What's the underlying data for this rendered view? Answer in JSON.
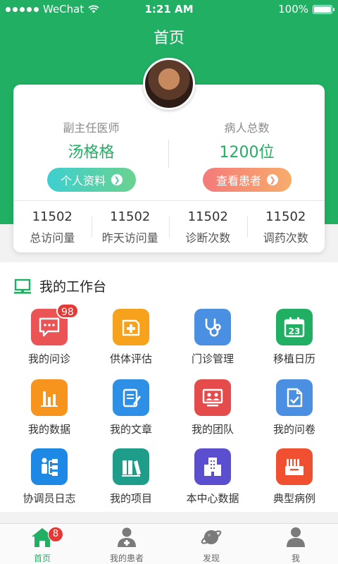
{
  "status_bar": {
    "carrier": "WeChat",
    "time": "1:21 AM",
    "battery": "100%"
  },
  "nav": {
    "title": "首页"
  },
  "profile": {
    "left": {
      "label": "副主任医师",
      "value": "汤格格",
      "button": "个人资料"
    },
    "right": {
      "label": "病人总数",
      "value": "1200位",
      "button": "查看患者"
    },
    "stats": [
      {
        "value": "11502",
        "label": "总访问量"
      },
      {
        "value": "11502",
        "label": "昨天访问量"
      },
      {
        "value": "11502",
        "label": "诊断次数"
      },
      {
        "value": "11502",
        "label": "调药次数"
      }
    ]
  },
  "workbench": {
    "title": "我的工作台",
    "items": [
      {
        "label": "我的问诊",
        "icon": "chat-icon",
        "color": "#ea5455",
        "badge": "98"
      },
      {
        "label": "供体评估",
        "icon": "medical-kit-icon",
        "color": "#f7a21c"
      },
      {
        "label": "门诊管理",
        "icon": "stethoscope-icon",
        "color": "#4a90e2"
      },
      {
        "label": "移植日历",
        "icon": "calendar-icon",
        "color": "#21b063",
        "day": "23"
      },
      {
        "label": "我的数据",
        "icon": "bar-chart-icon",
        "color": "#f7941d"
      },
      {
        "label": "我的文章",
        "icon": "article-icon",
        "color": "#2d8fe6"
      },
      {
        "label": "我的团队",
        "icon": "team-icon",
        "color": "#e54b4b"
      },
      {
        "label": "我的问卷",
        "icon": "questionnaire-icon",
        "color": "#4a8fe2"
      },
      {
        "label": "协调员日志",
        "icon": "org-chart-icon",
        "color": "#1e88e5"
      },
      {
        "label": "我的项目",
        "icon": "books-icon",
        "color": "#1e9d8b"
      },
      {
        "label": "本中心数据",
        "icon": "building-icon",
        "color": "#5b4fcf"
      },
      {
        "label": "典型病例",
        "icon": "case-folder-icon",
        "color": "#f0502f"
      }
    ]
  },
  "tabbar": {
    "items": [
      {
        "label": "首页",
        "icon": "home-icon",
        "active": true,
        "badge": "8"
      },
      {
        "label": "我的患者",
        "icon": "patients-icon",
        "active": false
      },
      {
        "label": "发现",
        "icon": "planet-icon",
        "active": false
      },
      {
        "label": "我",
        "icon": "user-icon",
        "active": false
      }
    ]
  },
  "colors": {
    "brand": "#21b063",
    "badge": "#e53935"
  }
}
